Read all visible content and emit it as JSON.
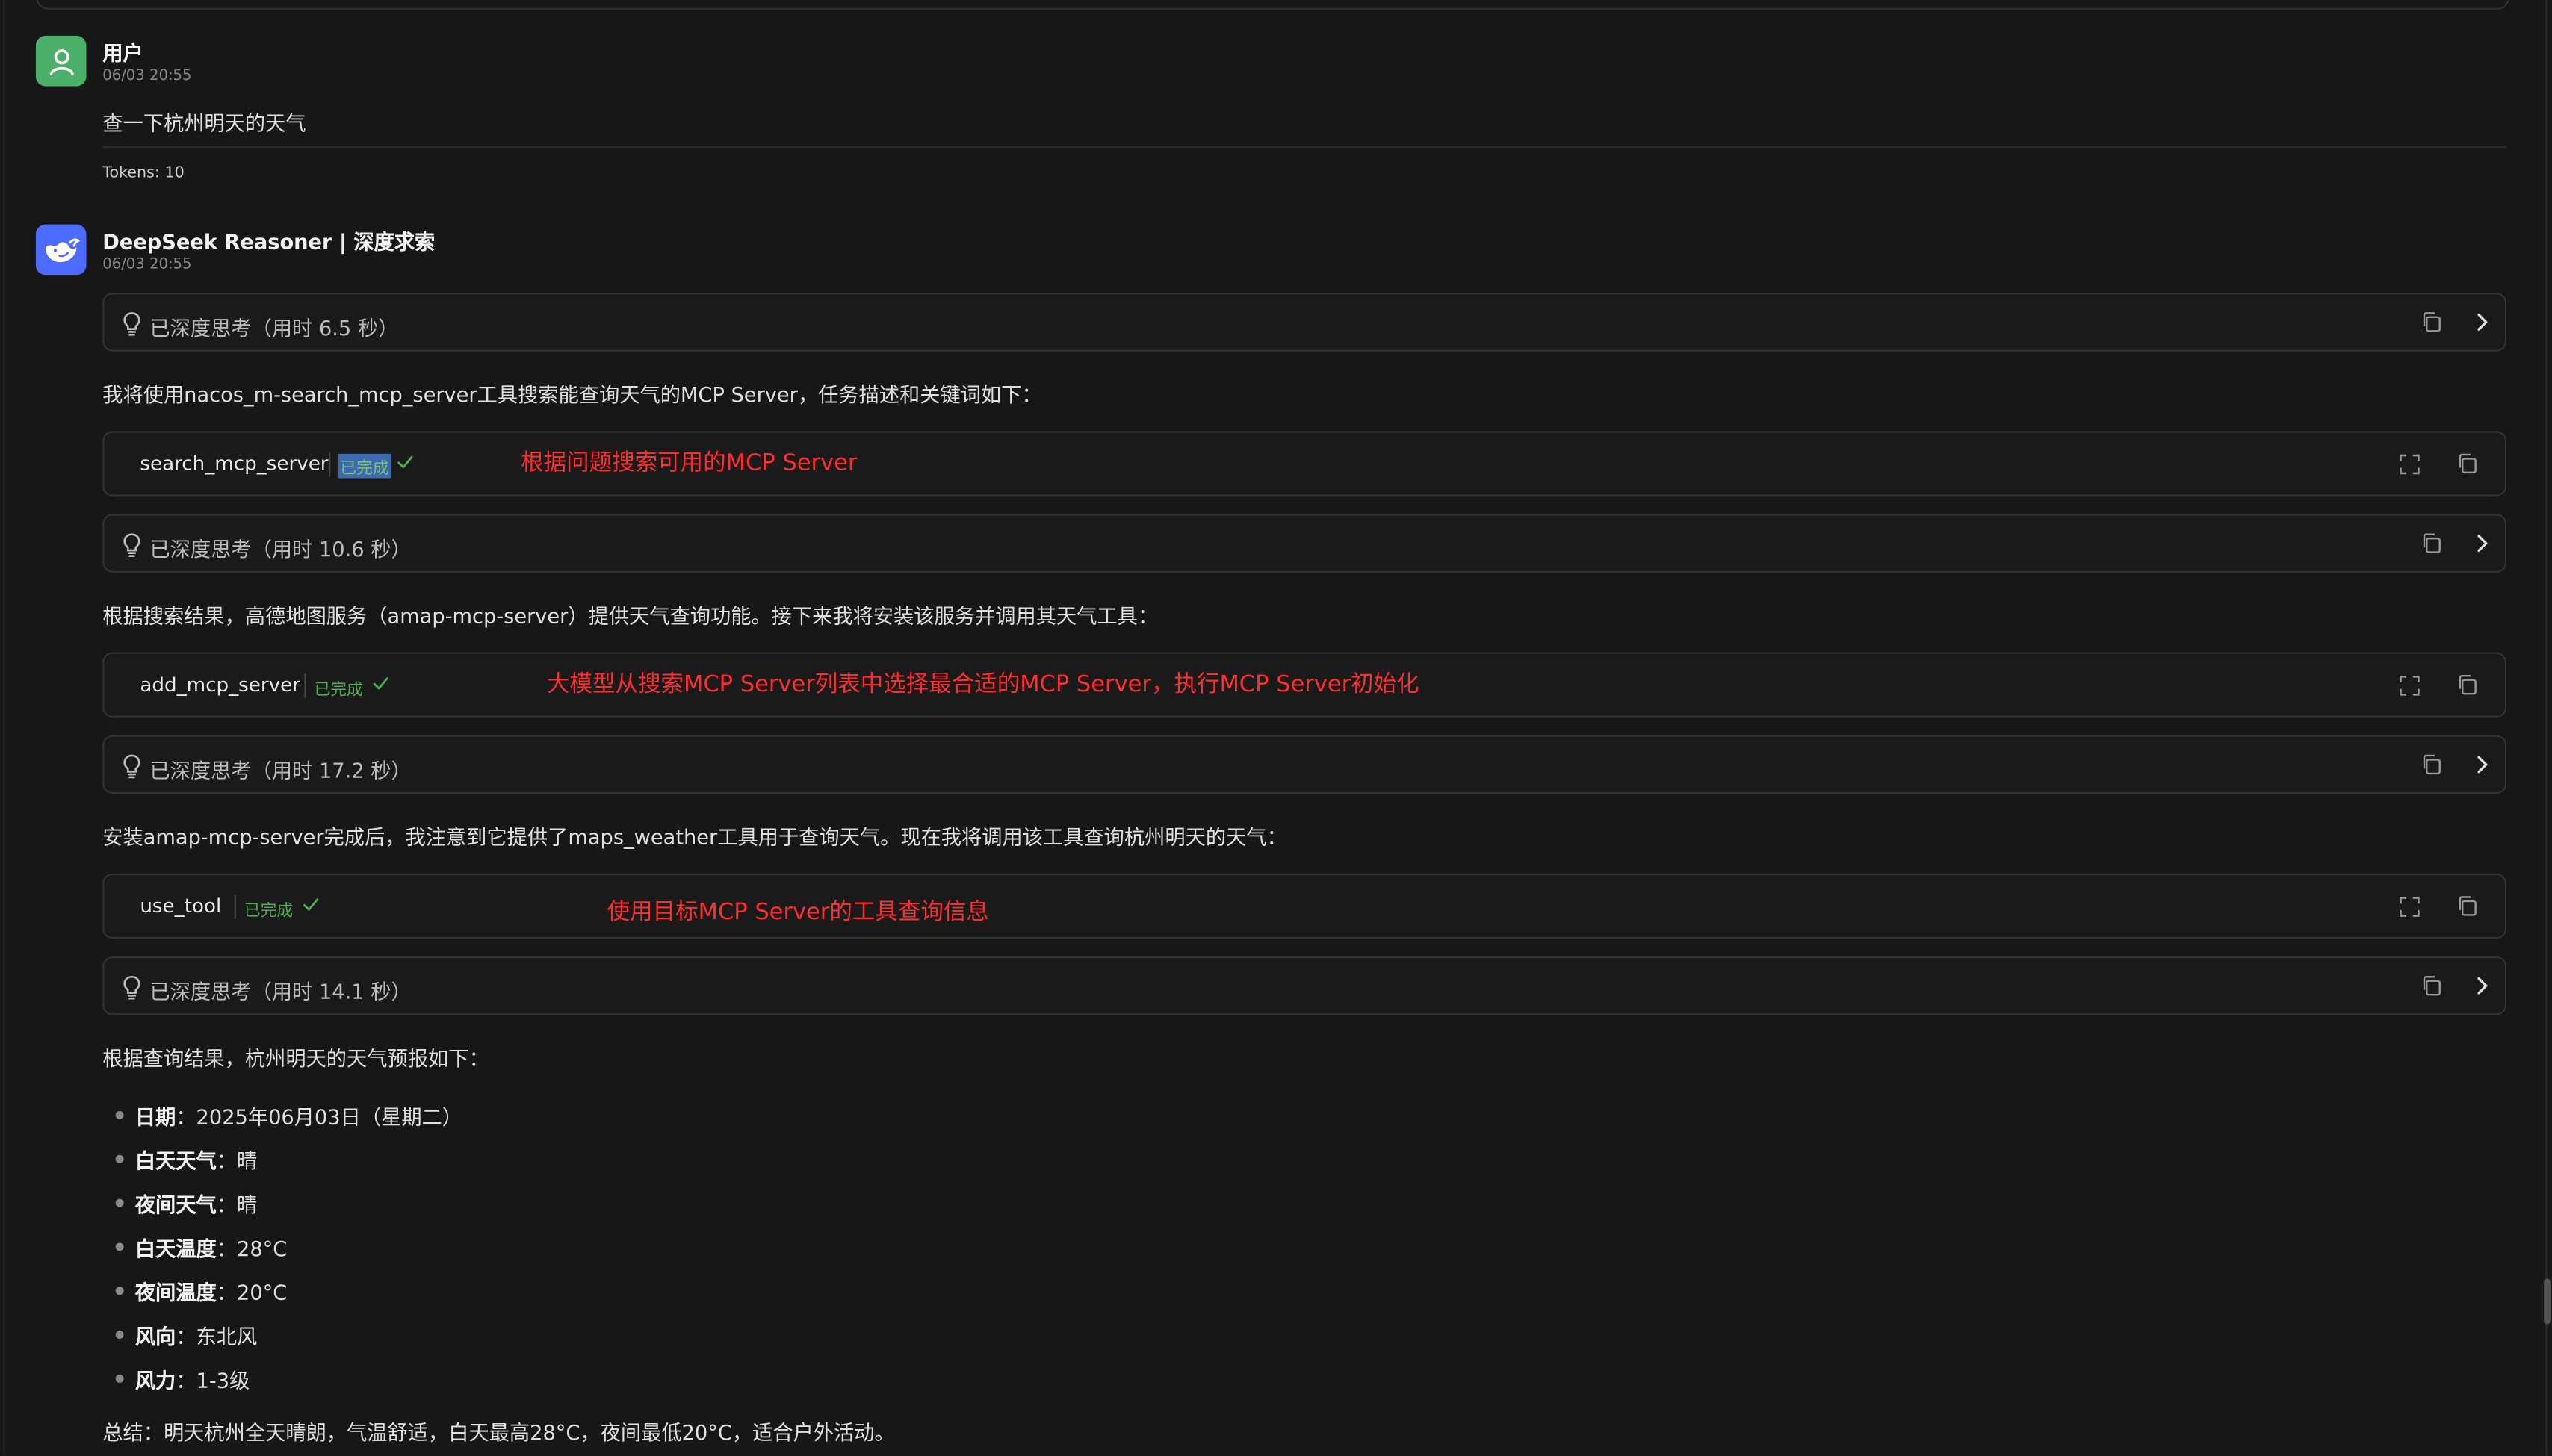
{
  "user_message": {
    "author": "用户",
    "timestamp": "06/03 20:55",
    "text": "查一下杭州明天的天气",
    "tokens": "Tokens: 10"
  },
  "assistant_message": {
    "author": "DeepSeek Reasoner | 深度求索",
    "timestamp": "06/03 20:55",
    "blocks": {
      "think1": "已深度思考（用时 6.5 秒）",
      "para1": "我将使用nacos_m-search_mcp_server工具搜索能查询天气的MCP Server，任务描述和关键词如下：",
      "tool1": {
        "name": "search_mcp_server",
        "status": "已完成",
        "annotation": "根据问题搜索可用的MCP Server"
      },
      "think2": "已深度思考（用时 10.6 秒）",
      "para2": "根据搜索结果，高德地图服务（amap-mcp-server）提供天气查询功能。接下来我将安装该服务并调用其天气工具：",
      "tool2": {
        "name": "add_mcp_server",
        "status": "已完成",
        "annotation": "大模型从搜索MCP Server列表中选择最合适的MCP Server，执行MCP Server初始化"
      },
      "think3": "已深度思考（用时 17.2 秒）",
      "para3": "安装amap-mcp-server完成后，我注意到它提供了maps_weather工具用于查询天气。现在我将调用该工具查询杭州明天的天气：",
      "tool3": {
        "name": "use_tool",
        "status": "已完成",
        "annotation": "使用目标MCP Server的工具查询信息"
      },
      "think4": "已深度思考（用时 14.1 秒）",
      "para4": "根据查询结果，杭州明天的天气预报如下：",
      "forecast": [
        {
          "key": "日期",
          "value": "：2025年06月03日（星期二）"
        },
        {
          "key": "白天天气",
          "value": "：晴"
        },
        {
          "key": "夜间天气",
          "value": "：晴"
        },
        {
          "key": "白天温度",
          "value": "：28°C"
        },
        {
          "key": "夜间温度",
          "value": "：20°C"
        },
        {
          "key": "风向",
          "value": "：东北风"
        },
        {
          "key": "风力",
          "value": "：1-3级"
        }
      ],
      "summary": "总结：明天杭州全天晴朗，气温舒适，白天最高28°C，夜间最低20°C，适合户外活动。"
    }
  },
  "colors": {
    "background": "#171717",
    "user_avatar": "#4caf6a",
    "assistant_avatar": "#4d6bfe",
    "status_done": "#4caf50",
    "annotation_red": "#ff2d2d"
  },
  "icons": {
    "user_avatar": "user-icon",
    "assistant_avatar": "whale-icon",
    "think": "lightbulb-icon",
    "copy": "copy-icon",
    "expand": "chevron-right-icon",
    "fullscreen": "fullscreen-icon",
    "done": "check-icon"
  }
}
